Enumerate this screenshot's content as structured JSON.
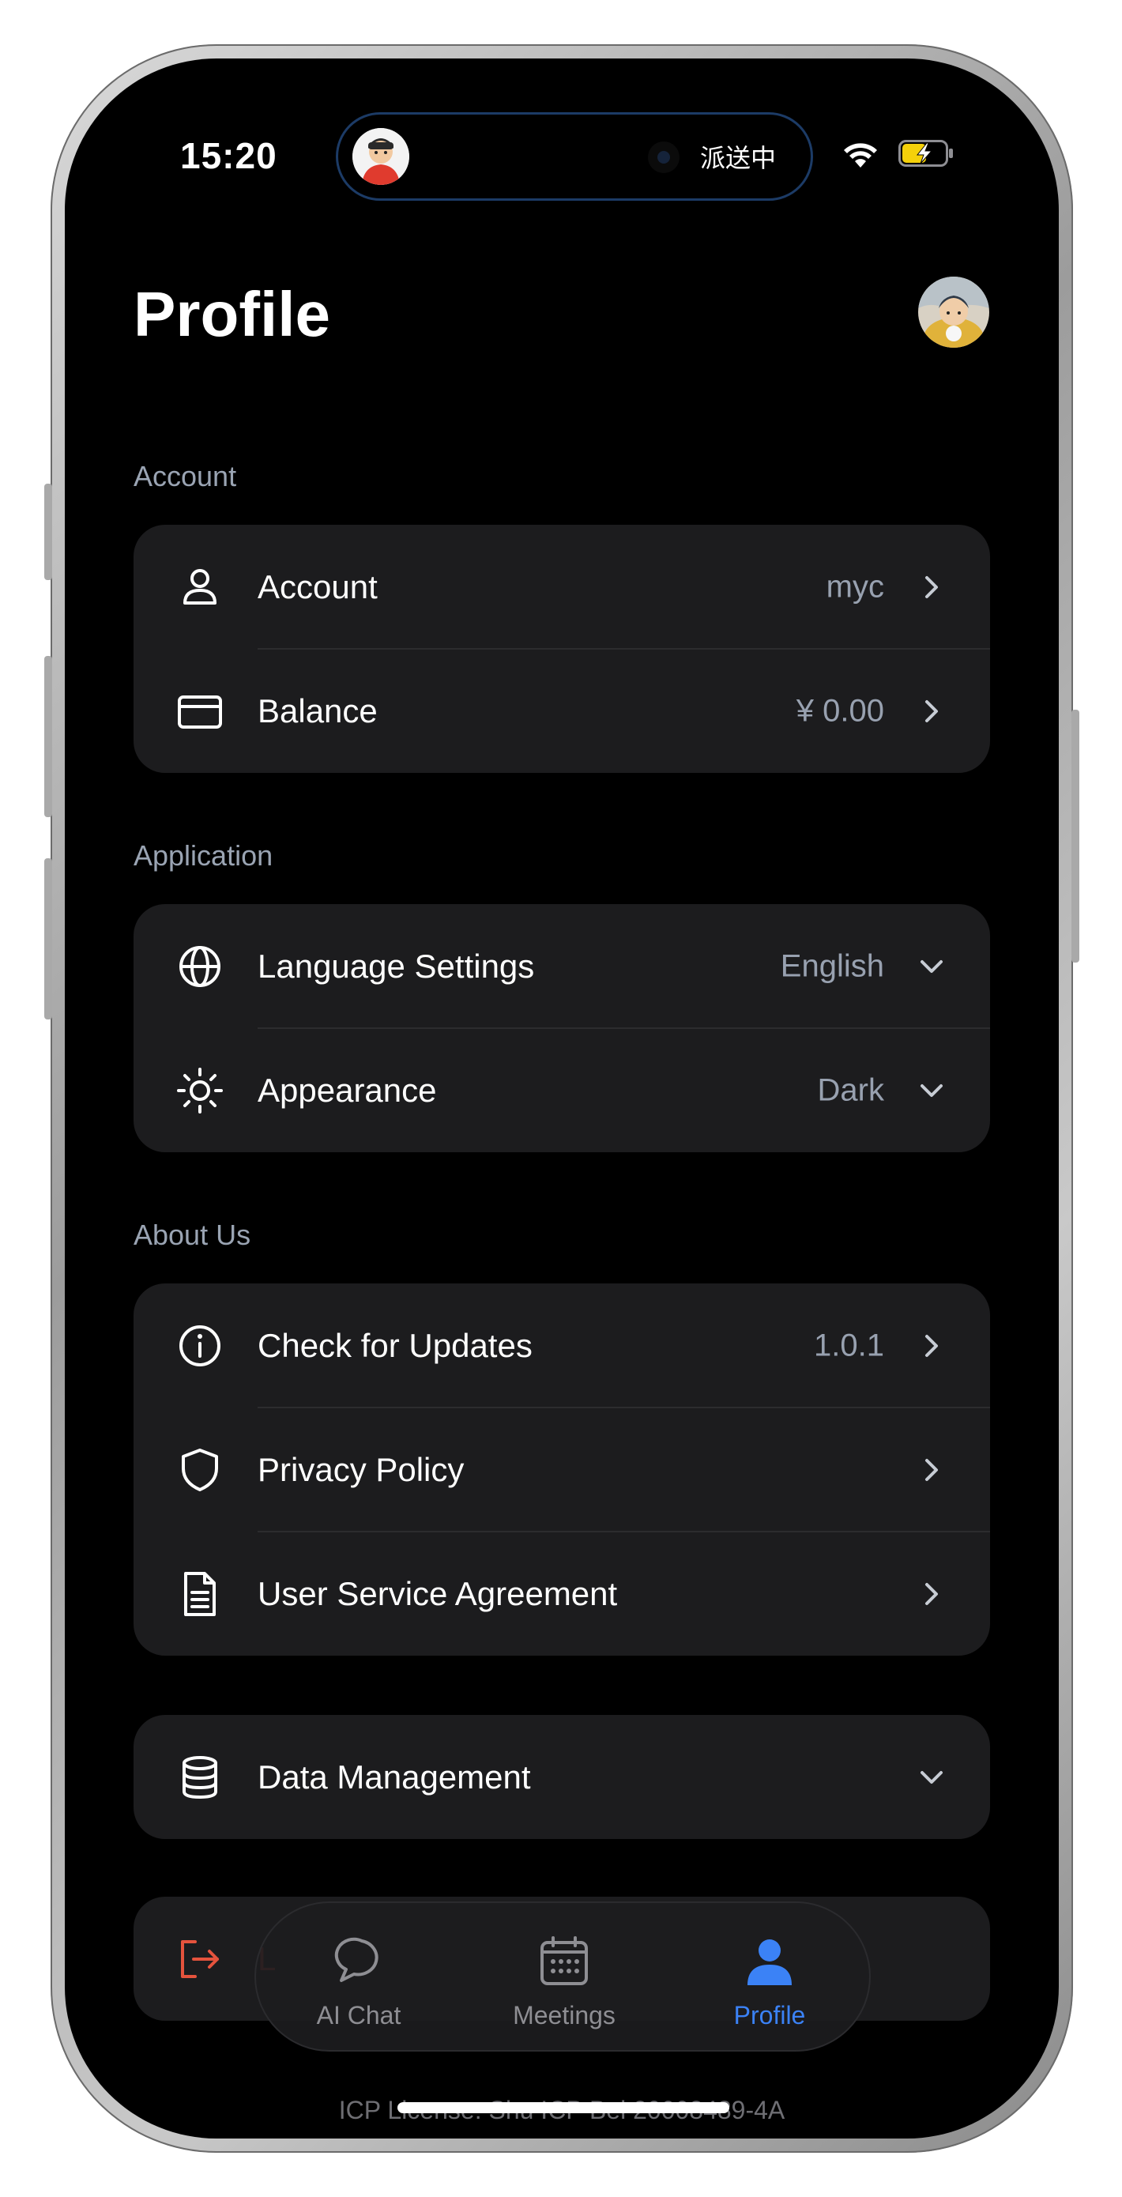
{
  "status": {
    "time": "15:20",
    "island_text": "派送中"
  },
  "page": {
    "title": "Profile"
  },
  "sections": {
    "account": {
      "label": "Account",
      "rows": [
        {
          "label": "Account",
          "value": "myc",
          "icon": "user-icon"
        },
        {
          "label": "Balance",
          "value": "¥ 0.00",
          "icon": "card-icon"
        }
      ]
    },
    "application": {
      "label": "Application",
      "rows": [
        {
          "label": "Language Settings",
          "value": "English",
          "icon": "globe-icon"
        },
        {
          "label": "Appearance",
          "value": "Dark",
          "icon": "sun-icon"
        }
      ]
    },
    "about": {
      "label": "About Us",
      "rows": [
        {
          "label": "Check for Updates",
          "value": "1.0.1",
          "icon": "info-icon"
        },
        {
          "label": "Privacy Policy",
          "value": "",
          "icon": "shield-icon"
        },
        {
          "label": "User Service Agreement",
          "value": "",
          "icon": "document-icon"
        }
      ]
    },
    "data": {
      "rows": [
        {
          "label": "Data Management",
          "icon": "database-icon"
        }
      ]
    },
    "logout": {
      "label": "L",
      "icon": "logout-icon"
    }
  },
  "tabbar": {
    "tabs": [
      {
        "label": "AI Chat",
        "icon": "chat-icon"
      },
      {
        "label": "Meetings",
        "icon": "calendar-icon"
      },
      {
        "label": "Profile",
        "icon": "person-icon",
        "active": true
      }
    ]
  },
  "footer": {
    "icp": "ICP License: Shu ICP Bei 20008489-4A"
  },
  "colors": {
    "accent": "#3b82f6",
    "card": "#1c1c1e",
    "logout": "#e5533d",
    "secondary_text": "#98a1b0"
  }
}
